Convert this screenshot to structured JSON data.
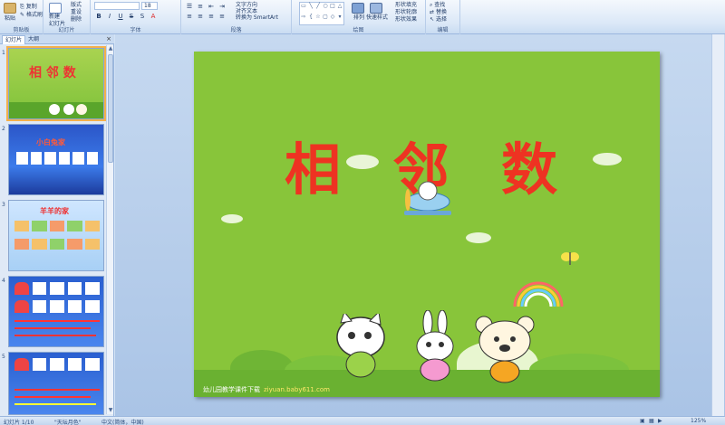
{
  "ribbon": {
    "paste_label": "粘贴",
    "copy_label": "复制",
    "format_painter_label": "格式刷",
    "new_slide_label": "新建\n幻灯片",
    "layout_label": "版式",
    "reset_label": "重设",
    "delete_label": "删除",
    "font_size_value": "18",
    "text_direction_label": "文字方向",
    "align_text_label": "对齐文本",
    "smartart_label": "转换为 SmartArt",
    "arrange_label": "排列",
    "quick_styles_label": "快速样式",
    "shape_fill_label": "形状填充",
    "shape_outline_label": "形状轮廓",
    "shape_effects_label": "形状效果",
    "find_label": "查找",
    "replace_label": "替换",
    "select_label": "选择",
    "groups": {
      "clipboard": "剪贴板",
      "slides": "幻灯片",
      "font": "字体",
      "paragraph": "段落",
      "drawing": "绘图",
      "editing": "编辑"
    }
  },
  "left_panel": {
    "tab_slides": "幻灯片",
    "tab_outline": "大纲",
    "close_glyph": "×",
    "thumbnails": [
      {
        "num": "1",
        "title": "相 邻 数"
      },
      {
        "num": "2",
        "title": "小白兔家"
      },
      {
        "num": "3",
        "title": "羊羊的家"
      },
      {
        "num": "4",
        "title": ""
      },
      {
        "num": "5",
        "title": ""
      }
    ]
  },
  "slide": {
    "title": "相 邻 数",
    "footer_text": "幼儿园教学课件下载",
    "footer_link": "ziyuan.baby611.com"
  },
  "status": {
    "slide_indicator": "幻灯片 1/10",
    "theme": "\"天坛月色\"",
    "language": "中文(简体，中国)",
    "zoom": "125%"
  },
  "colors": {
    "slide_bg": "#88c53a",
    "title_red": "#ee3322",
    "ribbon_bg": "#dbe8f7",
    "selection_orange": "#f4b04b"
  }
}
